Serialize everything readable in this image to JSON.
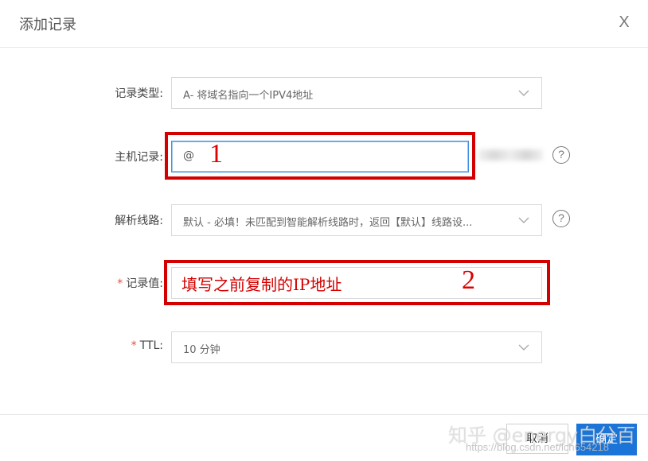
{
  "dialog": {
    "title": "添加记录",
    "close_label": "X"
  },
  "form": {
    "record_type": {
      "label": "记录类型:",
      "value": "A- 将域名指向一个IPV4地址"
    },
    "host_record": {
      "label": "主机记录:",
      "value": "@"
    },
    "line": {
      "label": "解析线路:",
      "value": "默认 - 必填！未匹配到智能解析线路时，返回【默认】线路设..."
    },
    "record_value": {
      "required_mark": "*",
      "label": "记录值:",
      "value": ""
    },
    "ttl": {
      "required_mark": "*",
      "label": "TTL:",
      "value": "10 分钟"
    }
  },
  "help_glyph": "?",
  "annotations": {
    "num_1": "1",
    "num_2": "2",
    "record_value_hint": "填写之前复制的IP地址",
    "color": "#d40000"
  },
  "footer": {
    "cancel_label": "取消",
    "ok_label": "确定"
  },
  "watermark": {
    "text": "知乎 @energy白分百",
    "url": "https://blog.csdn.net/lch654218"
  },
  "colors": {
    "primary": "#1b74d8",
    "required": "#e64c3c",
    "focus_border": "#3e8ee0"
  }
}
